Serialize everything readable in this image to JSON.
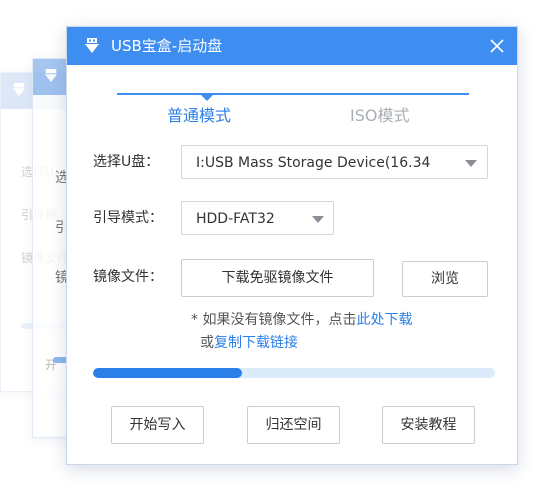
{
  "window": {
    "title": "USB宝盒-启动盘"
  },
  "tabs": [
    {
      "label": "普通模式",
      "active": true
    },
    {
      "label": "ISO模式",
      "active": false
    }
  ],
  "form": {
    "usb_label": "选择U盘：",
    "usb_value": "I:USB Mass Storage Device(16.34",
    "boot_label": "引导模式：",
    "boot_value": "HDD-FAT32",
    "image_label": "镜像文件：",
    "image_button": "下载免驱镜像文件",
    "browse_button": "浏览"
  },
  "note": {
    "prefix": "* 如果没有镜像文件，点击",
    "download_link": "此处下载",
    "or_text": "或",
    "copy_link": "复制下载链接"
  },
  "progress": {
    "fraction": 0.37
  },
  "actions": {
    "write_button": "开始写入",
    "restore_button": "归还空间",
    "tutorial_button": "安装教程"
  },
  "ghost_windows": {
    "labels": [
      "选择U",
      "引导模",
      "镜像文件"
    ],
    "ghost2_labels": [
      "选",
      "引",
      "镜"
    ],
    "ghost2_footer": "开"
  },
  "colors": {
    "accent": "#3d8ef0",
    "link": "#2a7fe8",
    "progress_track": "#dcebfa",
    "inactive_tab": "#a9aeb5"
  },
  "icons": {
    "app": "usb-drive-icon",
    "close": "close-icon",
    "dropdown": "chevron-down-icon"
  }
}
